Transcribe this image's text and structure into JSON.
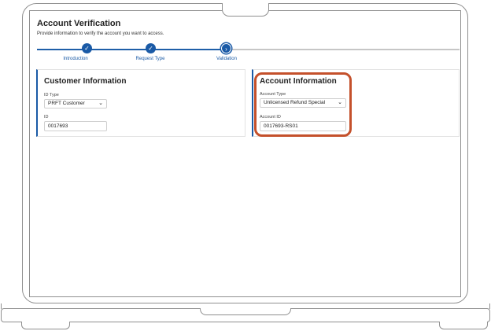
{
  "header": {
    "title": "Account Verification",
    "subtitle": "Provide information to verify the account you want to access."
  },
  "steps": [
    {
      "label": "Introduction",
      "state": "complete",
      "icon": "check-icon"
    },
    {
      "label": "Request Type",
      "state": "complete",
      "icon": "check-icon"
    },
    {
      "label": "Validation",
      "state": "current",
      "icon": "chevron-right-icon"
    }
  ],
  "customer": {
    "title": "Customer Information",
    "id_type_label": "ID Type",
    "id_type_value": "PRFT Customer",
    "id_label": "ID",
    "id_value": "0017693"
  },
  "account": {
    "title": "Account Information",
    "type_label": "Account Type",
    "type_value": "Unlicensed Refund Special",
    "id_label": "Account ID",
    "id_value": "0017693-RS01"
  },
  "colors": {
    "accent": "#1a5aa6",
    "highlight": "#c4502b"
  }
}
